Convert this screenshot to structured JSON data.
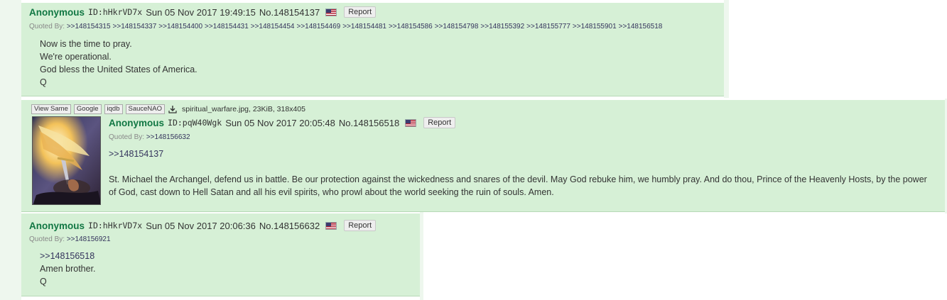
{
  "posts": [
    {
      "name": "Anonymous",
      "poster_id": "ID:hHkrVD7x",
      "datetime": "Sun 05 Nov 2017 19:49:15",
      "post_no": "No.148154137",
      "flag": "us-flag-icon",
      "report_label": "Report",
      "quoted_by_label": "Quoted By:",
      "quoted_by": [
        ">>148154315",
        ">>148154337",
        ">>148154400",
        ">>148154431",
        ">>148154454",
        ">>148154469",
        ">>148154481",
        ">>148154586",
        ">>148154798",
        ">>148155392",
        ">>148155777",
        ">>148155901",
        ">>148156518"
      ],
      "body": [
        "Now is the time to pray.",
        "We're operational.",
        "God bless the United States of America.",
        "Q"
      ]
    },
    {
      "name": "Anonymous",
      "poster_id": "ID:pqW40Wgk",
      "datetime": "Sun 05 Nov 2017 20:05:48",
      "post_no": "No.148156518",
      "flag": "us-flag-icon",
      "report_label": "Report",
      "quoted_by_label": "Quoted By:",
      "quoted_by": [
        ">>148156632"
      ],
      "file": {
        "buttons": [
          "View Same",
          "Google",
          "iqdb",
          "SauceNAO"
        ],
        "download_icon": "download-icon",
        "info": "spiritual_warfare.jpg, 23KiB, 318x405"
      },
      "reply_link": ">>148154137",
      "body_text": "St. Michael the Archangel, defend us in battle. Be our protection against the wickedness and snares of the devil. May God rebuke him, we humbly pray. And do thou, Prince of the Heavenly Hosts, by the power of God, cast down to Hell Satan and all his evil spirits, who prowl about the world seeking the ruin of souls. Amen."
    },
    {
      "name": "Anonymous",
      "poster_id": "ID:hHkrVD7x",
      "datetime": "Sun 05 Nov 2017 20:06:36",
      "post_no": "No.148156632",
      "flag": "us-flag-icon",
      "report_label": "Report",
      "quoted_by_label": "Quoted By:",
      "quoted_by": [
        ">>148156921"
      ],
      "body": [
        ">>148156518",
        "Amen brother.",
        "Q"
      ]
    }
  ],
  "colors": {
    "post_bg": "#d6f0d6",
    "name": "#117743",
    "link": "#34345c"
  }
}
